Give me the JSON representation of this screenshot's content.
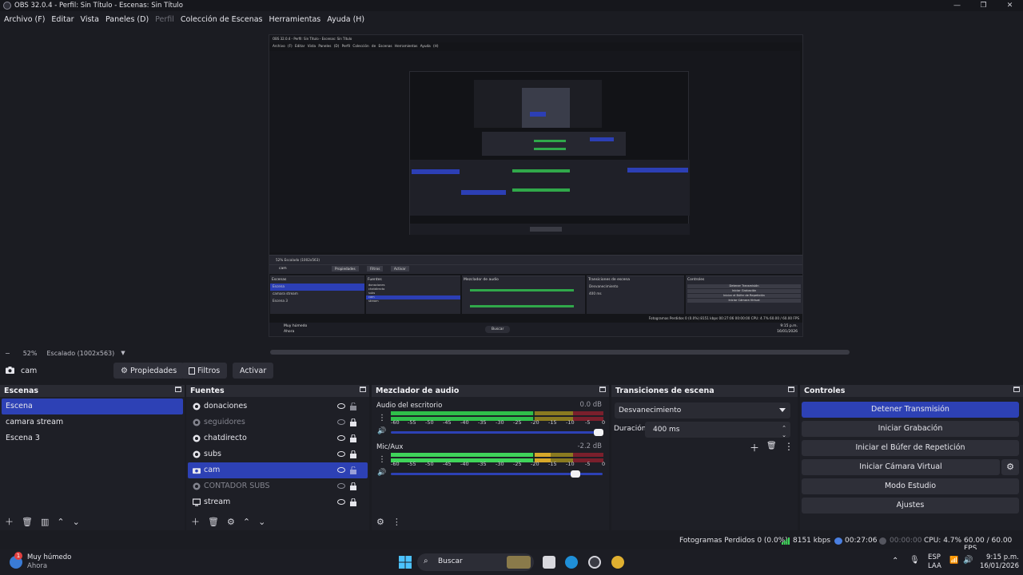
{
  "window": {
    "title": "OBS 32.0.4 - Perfil: Sin Título - Escenas: Sin Título",
    "controls": [
      "—",
      "❐",
      "✕"
    ]
  },
  "menu": [
    "Archivo (F)",
    "Editar",
    "Vista",
    "Paneles (D)",
    "Perfil",
    "Colección de Escenas",
    "Herramientas",
    "Ayuda (H)"
  ],
  "preview": {
    "nested_title": "OBS 32.0.4 - Perfil: Sin Título - Escenas: Sin Título",
    "nested_menu": "Archivo (F)  Editar  Vista  Paneles (D)  Perfil  Colección de Escenas  Herramientas  Ayuda (H)",
    "nested_zoom": "52%   Escalado (1002x563)",
    "nested_cam": "cam",
    "nested_props": "Propiedades",
    "nested_filters": "Filtros",
    "nested_activate": "Activar",
    "nested_status": "Fotogramas Perdidos 0 (0.0%)   8151 kbps   00:27:06   00:00:00   CPU: 4.7%   60.00 / 60.00 FPS",
    "nested_weather": "Muy húmedo",
    "nested_weather_sub": "Ahora",
    "nested_search": "Buscar",
    "nested_time": "9:15 p.m.",
    "nested_date": "16/01/2026"
  },
  "zoom": {
    "minus": "−",
    "level": "52%",
    "scale": "Escalado (1002x563)",
    "arrow": "▼"
  },
  "source_toolbar": {
    "source_name": "cam",
    "properties_label": "Propiedades",
    "filters_label": "Filtros",
    "activate_label": "Activar"
  },
  "scenes": {
    "title": "Escenas",
    "items": [
      {
        "label": "Escena",
        "selected": true
      },
      {
        "label": "camara stream",
        "selected": false
      },
      {
        "label": "Escena 3",
        "selected": false
      }
    ]
  },
  "sources": {
    "title": "Fuentes",
    "items": [
      {
        "label": "donaciones",
        "icon": "browser-icon",
        "visible": true
      },
      {
        "label": "seguidores",
        "icon": "browser-icon",
        "visible": false
      },
      {
        "label": "chatdirecto",
        "icon": "browser-icon",
        "visible": true
      },
      {
        "label": "subs",
        "icon": "browser-icon",
        "visible": true
      },
      {
        "label": "cam",
        "icon": "camera-icon",
        "visible": true,
        "selected": true
      },
      {
        "label": "CONTADOR SUBS",
        "icon": "browser-icon",
        "visible": false
      },
      {
        "label": "stream",
        "icon": "monitor-icon",
        "visible": true
      }
    ]
  },
  "mixer": {
    "title": "Mezclador de audio",
    "channels": [
      {
        "name": "Audio del escritorio",
        "db": "0.0 dB",
        "level": 0.0,
        "volume": 1.0
      },
      {
        "name": "Mic/Aux",
        "db": "-2.2 dB",
        "level": 0.84,
        "volume": 0.86
      }
    ],
    "ticks": [
      "-60",
      "-55",
      "-50",
      "-45",
      "-40",
      "-35",
      "-30",
      "-25",
      "-20",
      "-15",
      "-10",
      "-5",
      "0"
    ]
  },
  "transitions": {
    "title": "Transiciones de escena",
    "selected": "Desvanecimiento",
    "duration_label": "Duración",
    "duration_value": "400 ms"
  },
  "controls": {
    "title": "Controles",
    "buttons": [
      {
        "label": "Detener Transmisión",
        "primary": true
      },
      {
        "label": "Iniciar Grabación"
      },
      {
        "label": "Iniciar el Búfer de Repetición"
      },
      {
        "label": "Iniciar Cámara Virtual"
      },
      {
        "label": "Modo Estudio"
      },
      {
        "label": "Ajustes"
      }
    ]
  },
  "status": {
    "dropped": "Fotogramas Perdidos 0 (0.0%)",
    "bitrate": "8151 kbps",
    "stream_time": "00:27:06",
    "rec_time": "00:00:00",
    "cpu": "CPU: 4.7%",
    "fps": "60.00 / 60.00 FPS"
  },
  "taskbar": {
    "weather": "Muy húmedo",
    "weather_sub": "Ahora",
    "search": "Buscar",
    "lang": "ESP",
    "lang_sub": "LAA",
    "time": "9:15 p.m.",
    "date": "16/01/2026",
    "badge": "1"
  },
  "colors": {
    "accent": "#2d41b5",
    "meter_green": "#2fbf4a",
    "meter_yellow": "#c9a227",
    "meter_red": "#c0263e",
    "background": "#1b1c22"
  }
}
